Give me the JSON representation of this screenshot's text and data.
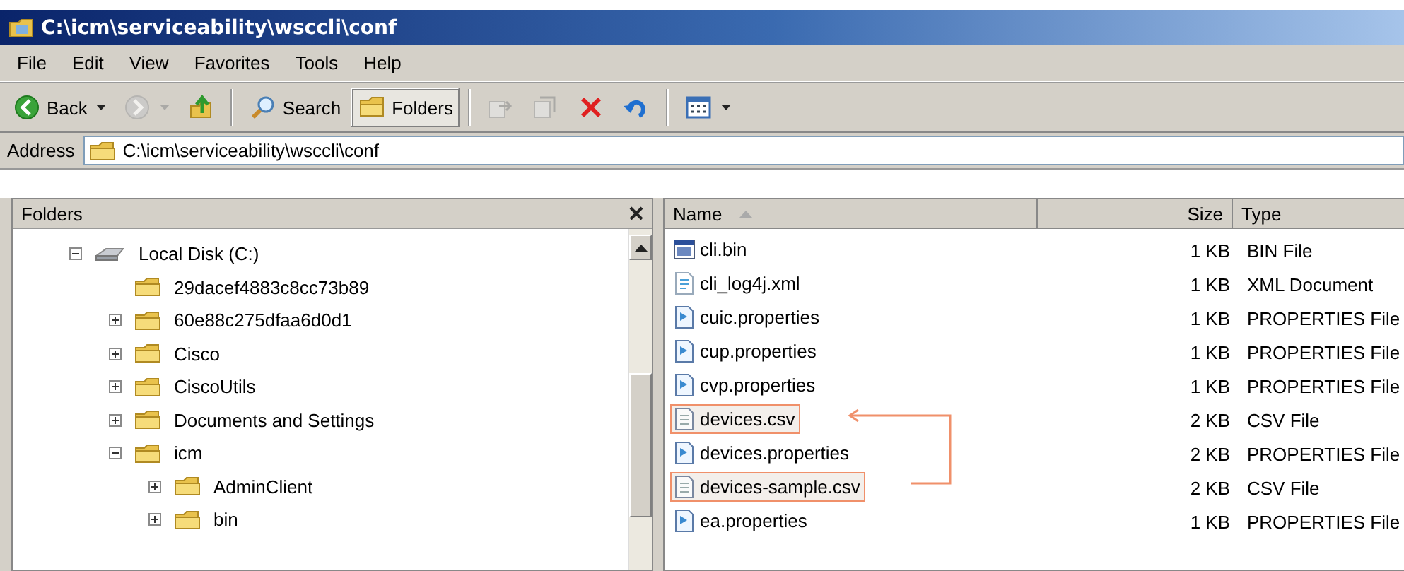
{
  "window": {
    "title": "C:\\icm\\serviceability\\wsccli\\conf"
  },
  "menu": [
    "File",
    "Edit",
    "View",
    "Favorites",
    "Tools",
    "Help"
  ],
  "toolbar": {
    "groups": [
      [
        {
          "kind": "back",
          "label": "Back",
          "disabled": false,
          "selected": false,
          "dropdown": true
        },
        {
          "kind": "forward",
          "disabled": true,
          "selected": false,
          "dropdown": true
        },
        {
          "kind": "up",
          "disabled": false,
          "selected": false,
          "dropdown": false
        }
      ],
      [
        {
          "kind": "search",
          "label": "Search",
          "disabled": false,
          "selected": false,
          "dropdown": false
        },
        {
          "kind": "folders",
          "label": "Folders",
          "disabled": false,
          "selected": true,
          "dropdown": false
        }
      ],
      [
        {
          "kind": "move",
          "disabled": true,
          "selected": false,
          "dropdown": false
        },
        {
          "kind": "copy",
          "disabled": true,
          "selected": false,
          "dropdown": false
        },
        {
          "kind": "delete",
          "disabled": false,
          "selected": false,
          "dropdown": false
        },
        {
          "kind": "undo",
          "disabled": false,
          "selected": false,
          "dropdown": false
        }
      ],
      [
        {
          "kind": "views",
          "disabled": false,
          "selected": false,
          "dropdown": true
        }
      ]
    ]
  },
  "address": {
    "label": "Address",
    "value": "C:\\icm\\serviceability\\wsccli\\conf"
  },
  "folders_pane": {
    "title": "Folders",
    "tree": [
      {
        "label": "Local Disk (C:)",
        "kind": "drive",
        "expandable": true,
        "expanded": true,
        "children": [
          {
            "label": "29dacef4883c8cc73b89",
            "kind": "folder",
            "expandable": false,
            "expanded": false
          },
          {
            "label": "60e88c275dfaa6d0d1",
            "kind": "folder",
            "expandable": true,
            "expanded": false
          },
          {
            "label": "Cisco",
            "kind": "folder",
            "expandable": true,
            "expanded": false
          },
          {
            "label": "CiscoUtils",
            "kind": "folder",
            "expandable": true,
            "expanded": false
          },
          {
            "label": "Documents and Settings",
            "kind": "folder",
            "expandable": true,
            "expanded": false
          },
          {
            "label": "icm",
            "kind": "folder",
            "expandable": true,
            "expanded": true,
            "children": [
              {
                "label": "AdminClient",
                "kind": "folder",
                "expandable": true,
                "expanded": false
              },
              {
                "label": "bin",
                "kind": "folder",
                "expandable": true,
                "expanded": false
              }
            ]
          }
        ]
      }
    ]
  },
  "file_list": {
    "columns": [
      {
        "label": "Name",
        "sorted": true
      },
      {
        "label": "Size",
        "sorted": false
      },
      {
        "label": "Type",
        "sorted": false
      }
    ],
    "rows": [
      {
        "name": "cli.bin",
        "size": "1 KB",
        "type": "BIN File",
        "kind": "bin",
        "highlighted": false
      },
      {
        "name": "cli_log4j.xml",
        "size": "1 KB",
        "type": "XML Document",
        "kind": "xml",
        "highlighted": false
      },
      {
        "name": "cuic.properties",
        "size": "1 KB",
        "type": "PROPERTIES File",
        "kind": "properties",
        "highlighted": false
      },
      {
        "name": "cup.properties",
        "size": "1 KB",
        "type": "PROPERTIES File",
        "kind": "properties",
        "highlighted": false
      },
      {
        "name": "cvp.properties",
        "size": "1 KB",
        "type": "PROPERTIES File",
        "kind": "properties",
        "highlighted": false
      },
      {
        "name": "devices.csv",
        "size": "2 KB",
        "type": "CSV File",
        "kind": "csv",
        "highlighted": true
      },
      {
        "name": "devices.properties",
        "size": "2 KB",
        "type": "PROPERTIES File",
        "kind": "properties",
        "highlighted": false
      },
      {
        "name": "devices-sample.csv",
        "size": "2 KB",
        "type": "CSV File",
        "kind": "csv",
        "highlighted": true
      },
      {
        "name": "ea.properties",
        "size": "1 KB",
        "type": "PROPERTIES File",
        "kind": "properties",
        "highlighted": false
      }
    ]
  }
}
